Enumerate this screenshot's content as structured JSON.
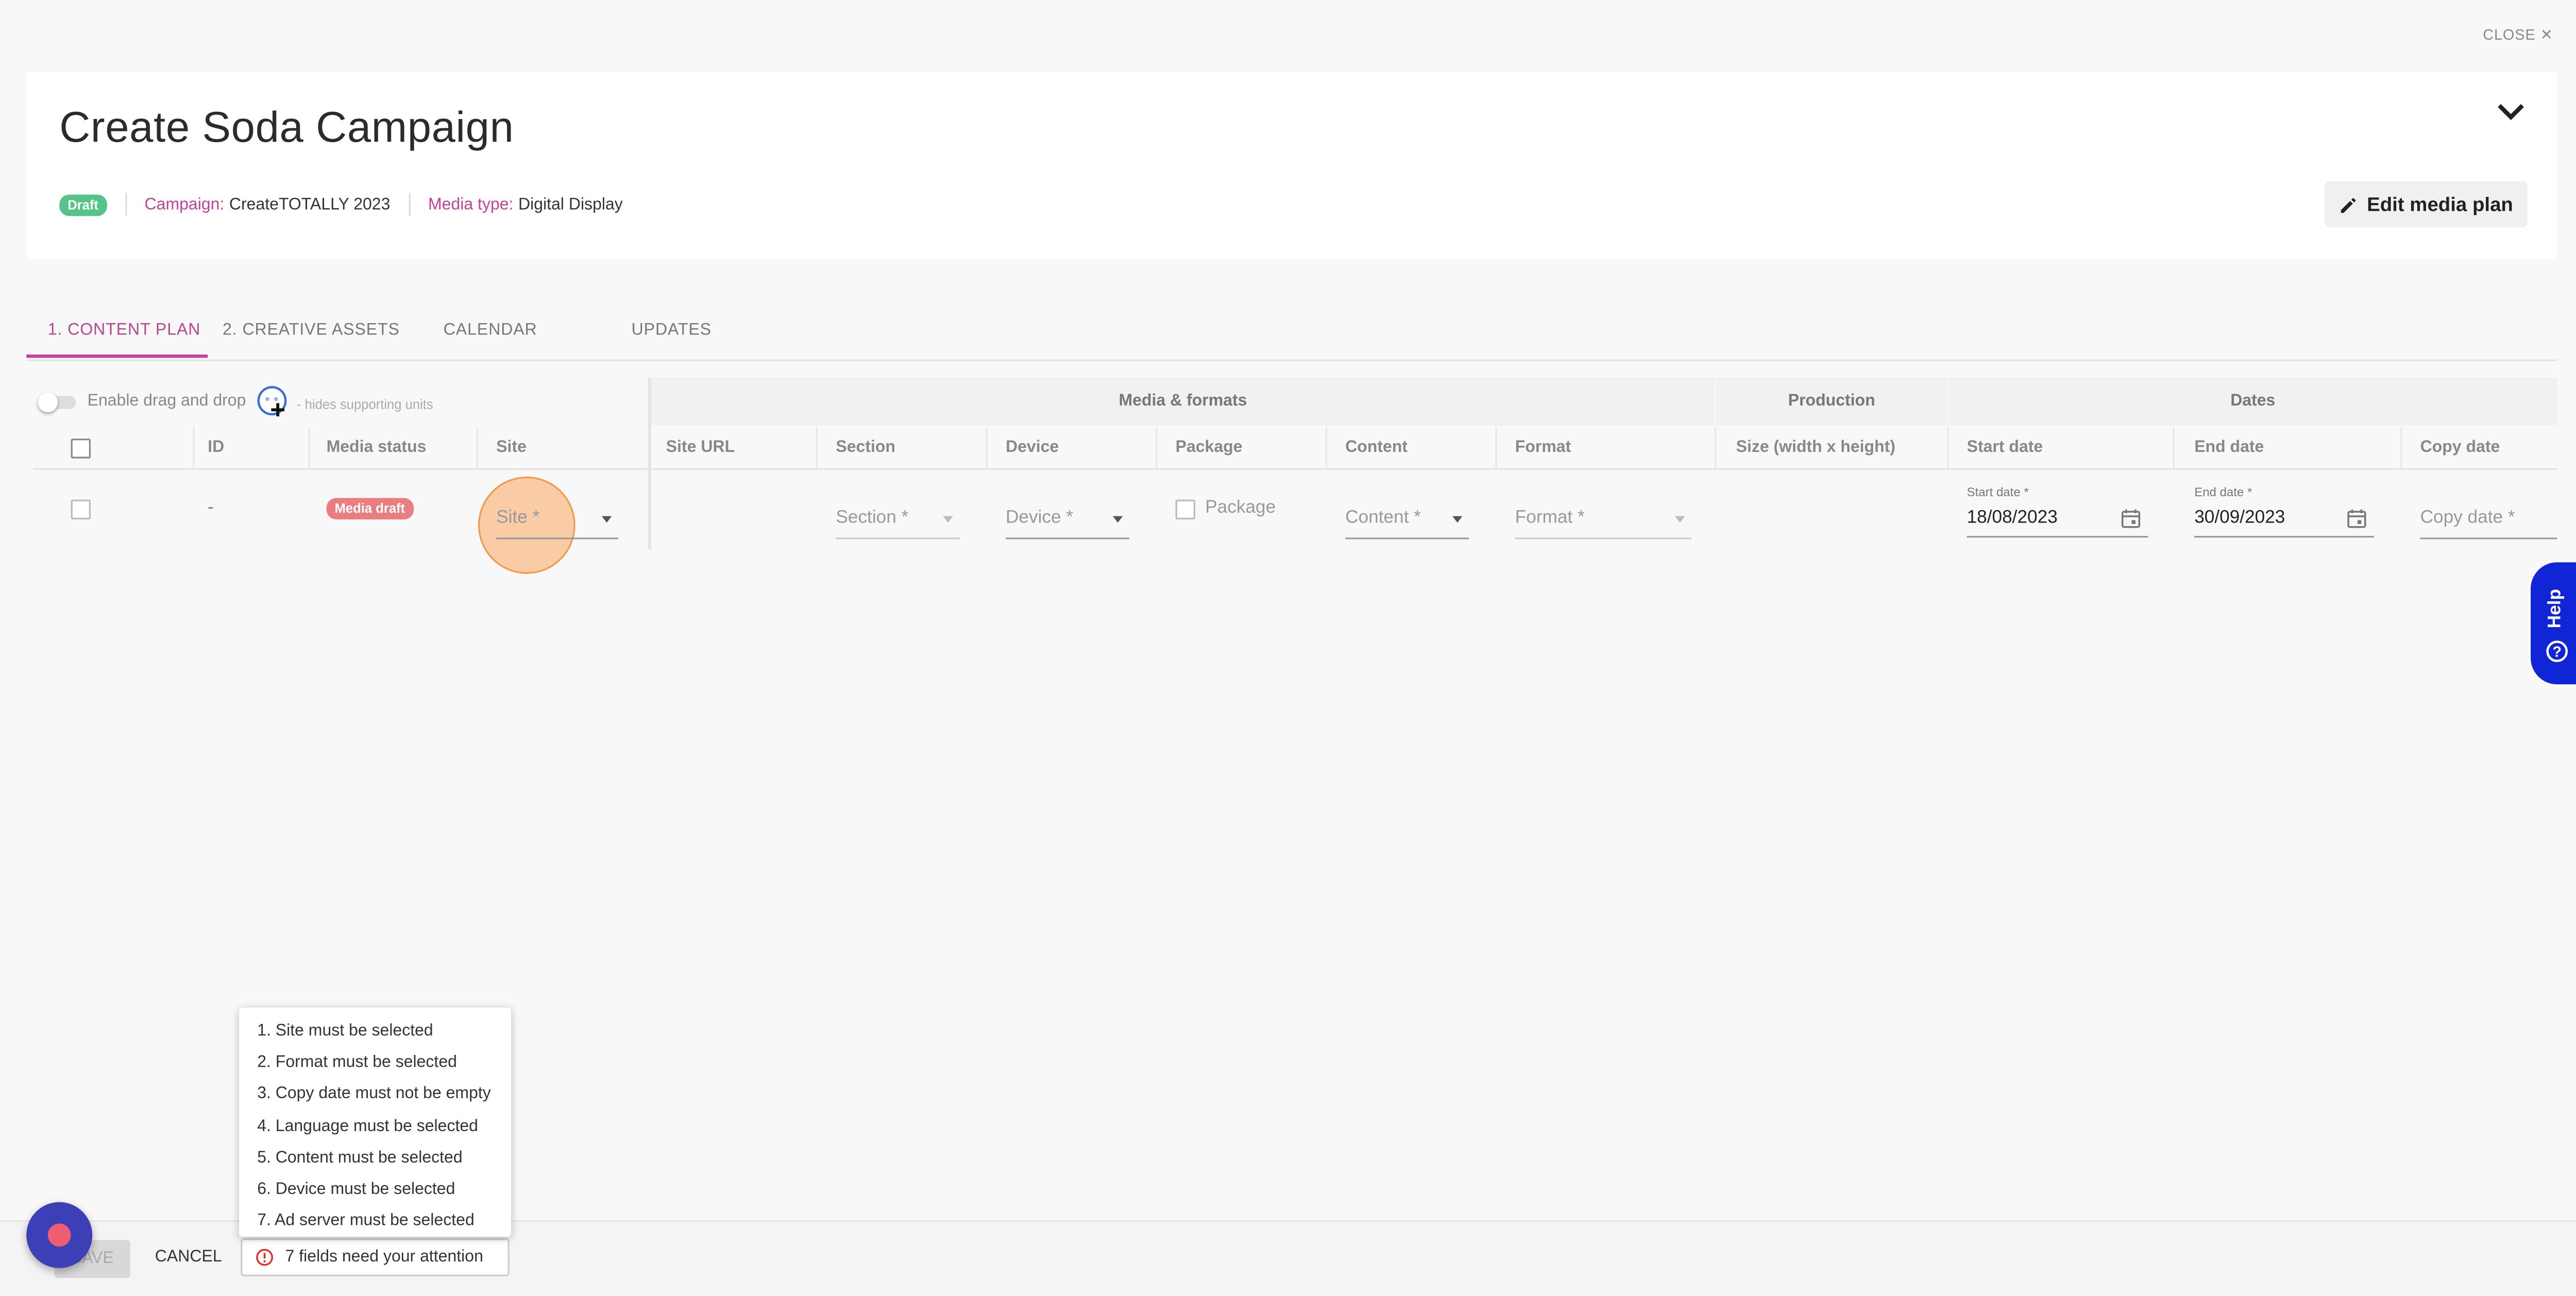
{
  "header": {
    "close_label": "CLOSE",
    "title": "Create Soda Campaign",
    "status_badge": "Draft",
    "campaign_label": "Campaign:",
    "campaign_value": "CreateTOTALLY 2023",
    "media_type_label": "Media type:",
    "media_type_value": "Digital Display",
    "edit_button": "Edit media plan"
  },
  "tabs": [
    {
      "label": "1. CONTENT PLAN",
      "active": true
    },
    {
      "label": "2. CREATIVE ASSETS",
      "active": false
    },
    {
      "label": "CALENDAR",
      "active": false
    },
    {
      "label": "UPDATES",
      "active": false
    }
  ],
  "toolbar": {
    "drag_drop_label": "Enable drag and drop",
    "hides_label": "- hides supporting units"
  },
  "table": {
    "groups": [
      "Media & formats",
      "Production",
      "Dates"
    ],
    "columns": [
      "ID",
      "Media status",
      "Site",
      "Site URL",
      "Section",
      "Device",
      "Package",
      "Content",
      "Format",
      "Size (width x height)",
      "Start date",
      "End date",
      "Copy date"
    ],
    "row": {
      "id": "-",
      "media_status": "Media draft",
      "site_placeholder": "Site *",
      "section_placeholder": "Section *",
      "device_placeholder": "Device *",
      "package_label": "Package",
      "content_placeholder": "Content *",
      "format_placeholder": "Format *",
      "start_date_label": "Start date *",
      "start_date_value": "18/08/2023",
      "end_date_label": "End date *",
      "end_date_value": "30/09/2023",
      "copy_date_placeholder": "Copy date *"
    }
  },
  "help_label": "Help",
  "footer": {
    "save_label": "SAVE",
    "cancel_label": "CANCEL",
    "attention_label": "7 fields need your attention"
  },
  "errors": [
    "1. Site must be selected",
    "2. Format must be selected",
    "3. Copy date must not be empty",
    "4. Language must be selected",
    "5. Content must be selected",
    "6. Device must be selected",
    "7. Ad server must be selected"
  ],
  "colors": {
    "accent": "#c2419a",
    "draft_badge": "#55c48a",
    "media_draft_badge": "#ea7d7d",
    "help_button": "#1026d6",
    "highlight": "#fbaf6e"
  }
}
